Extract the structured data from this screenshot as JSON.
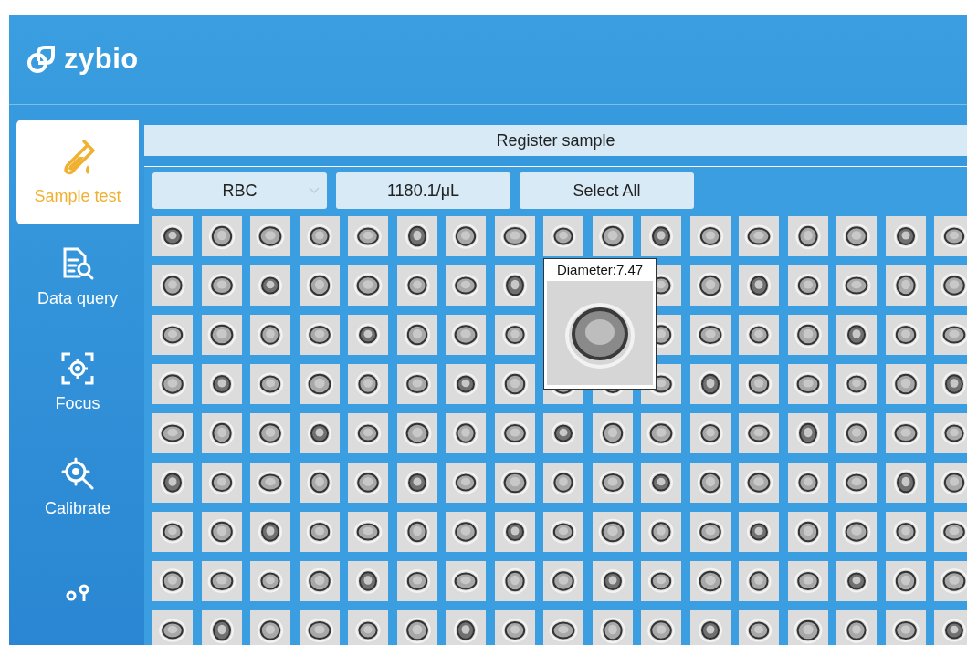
{
  "header": {
    "logo_text": "zybio"
  },
  "sidebar": {
    "items": [
      {
        "label": "Sample test",
        "selected": true
      },
      {
        "label": "Data query",
        "selected": false
      },
      {
        "label": "Focus",
        "selected": false
      },
      {
        "label": "Calibrate",
        "selected": false
      },
      {
        "selected": false
      }
    ]
  },
  "register_bar": {
    "label": "Register sample"
  },
  "toolbar": {
    "cell_type": "RBC",
    "concentration": "1180.1/μL",
    "select_all": "Select All"
  },
  "tooltip": {
    "text": "Diameter:7.47"
  }
}
